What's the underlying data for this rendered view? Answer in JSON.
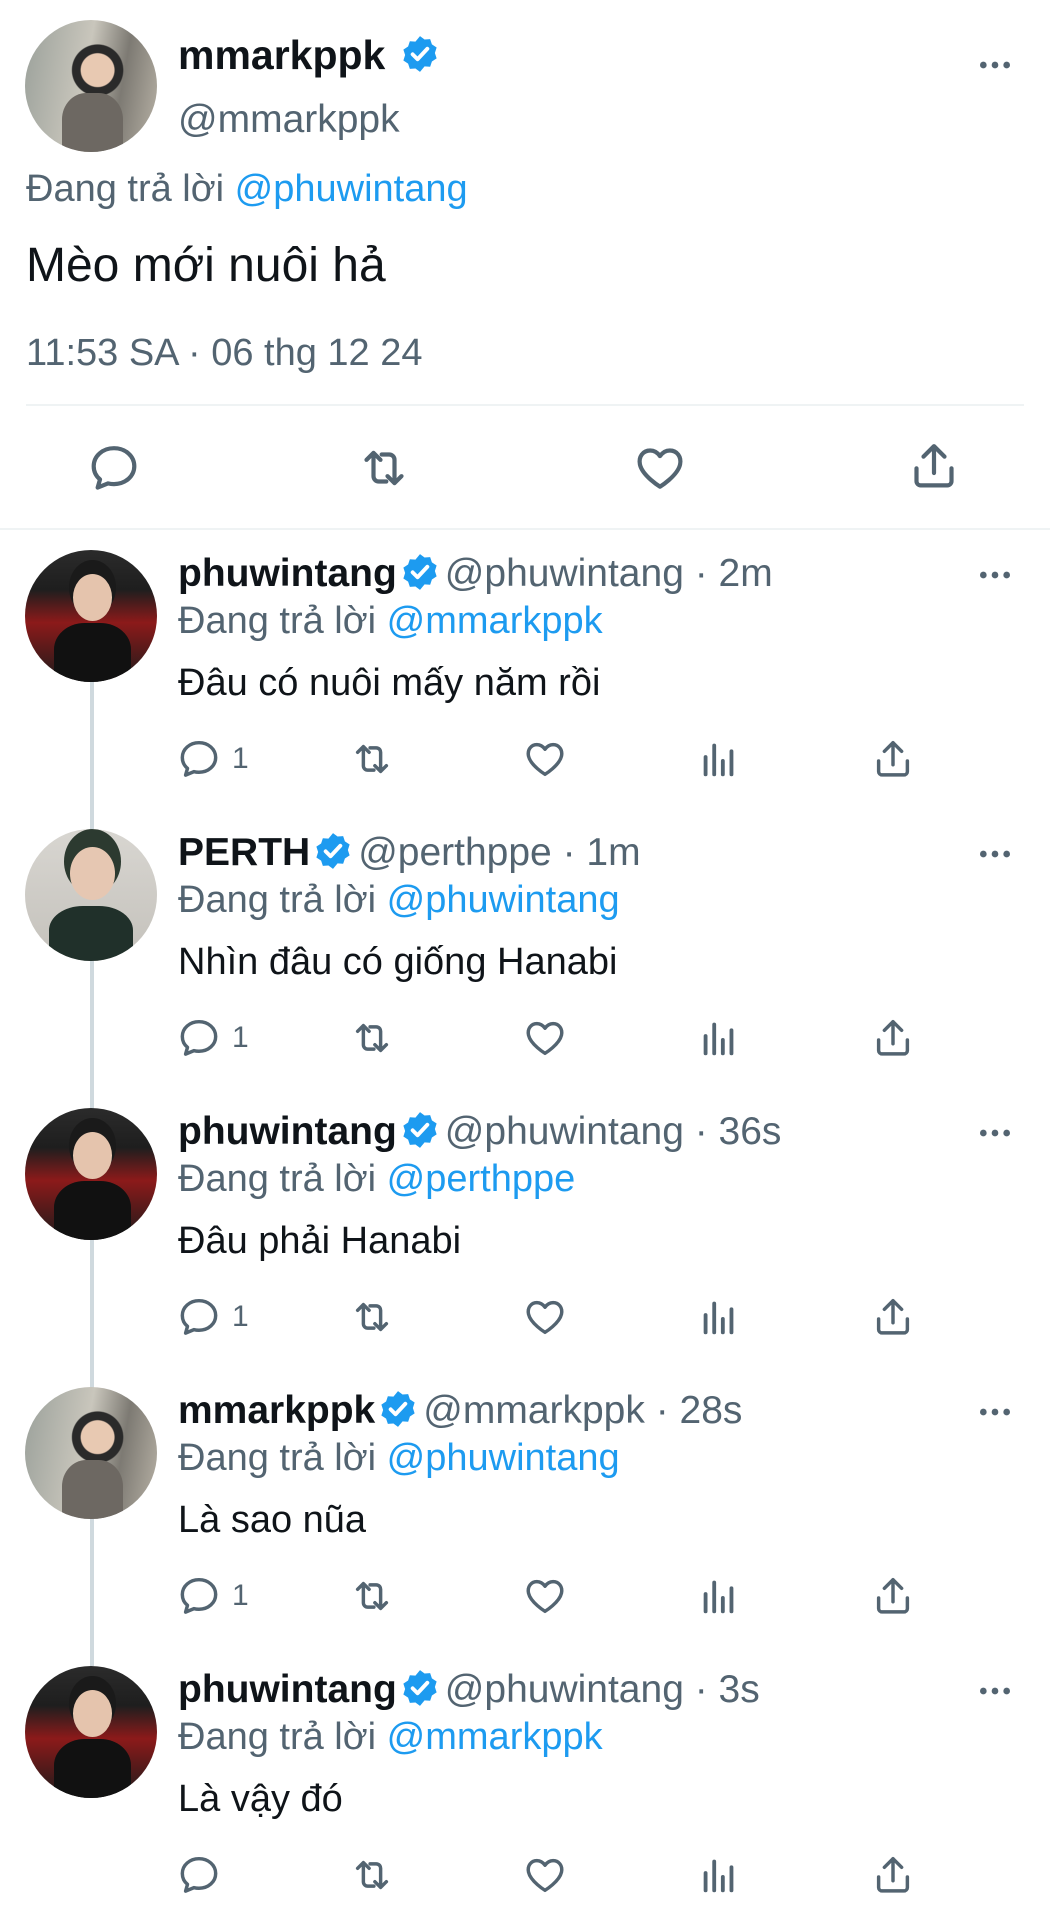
{
  "main_tweet": {
    "display_name": "mmarkppk",
    "handle": "@mmarkppk",
    "reply_prefix": "Đang trả lời",
    "reply_to": "@phuwintang",
    "text": "Mèo mới nuôi hả",
    "timestamp": "11:53 SA · 06 thg 12 24"
  },
  "replies": [
    {
      "display_name": "phuwintang",
      "handle": "@phuwintang · 2m",
      "reply_prefix": "Đang trả lời",
      "reply_to": "@mmarkppk",
      "text": "Đâu có nuôi mấy năm rồi",
      "reply_count": "1"
    },
    {
      "display_name": "PERTH",
      "handle": "@perthppe · 1m",
      "reply_prefix": "Đang trả lời",
      "reply_to": "@phuwintang",
      "text": "Nhìn đâu có giống Hanabi",
      "reply_count": "1"
    },
    {
      "display_name": "phuwintang",
      "handle": "@phuwintang · 36s",
      "reply_prefix": "Đang trả lời",
      "reply_to": "@perthppe",
      "text": "Đâu phải Hanabi",
      "reply_count": "1"
    },
    {
      "display_name": "mmarkppk",
      "handle": "@mmarkppk · 28s",
      "reply_prefix": "Đang trả lời",
      "reply_to": "@phuwintang",
      "text": "Là sao nũa",
      "reply_count": "1"
    },
    {
      "display_name": "phuwintang",
      "handle": "@phuwintang · 3s",
      "reply_prefix": "Đang trả lời",
      "reply_to": "@mmarkppk",
      "text": "Là vậy đó",
      "reply_count": ""
    }
  ],
  "icons": {
    "reply": "reply-icon",
    "retweet": "retweet-icon",
    "like": "heart-icon",
    "views": "views-icon",
    "share": "share-icon",
    "more": "more-icon",
    "verified": "verified-badge-icon"
  },
  "colors": {
    "link": "#1d9bf0",
    "text": "#0f1419",
    "muted": "#536471",
    "divider": "#eff3f4"
  }
}
